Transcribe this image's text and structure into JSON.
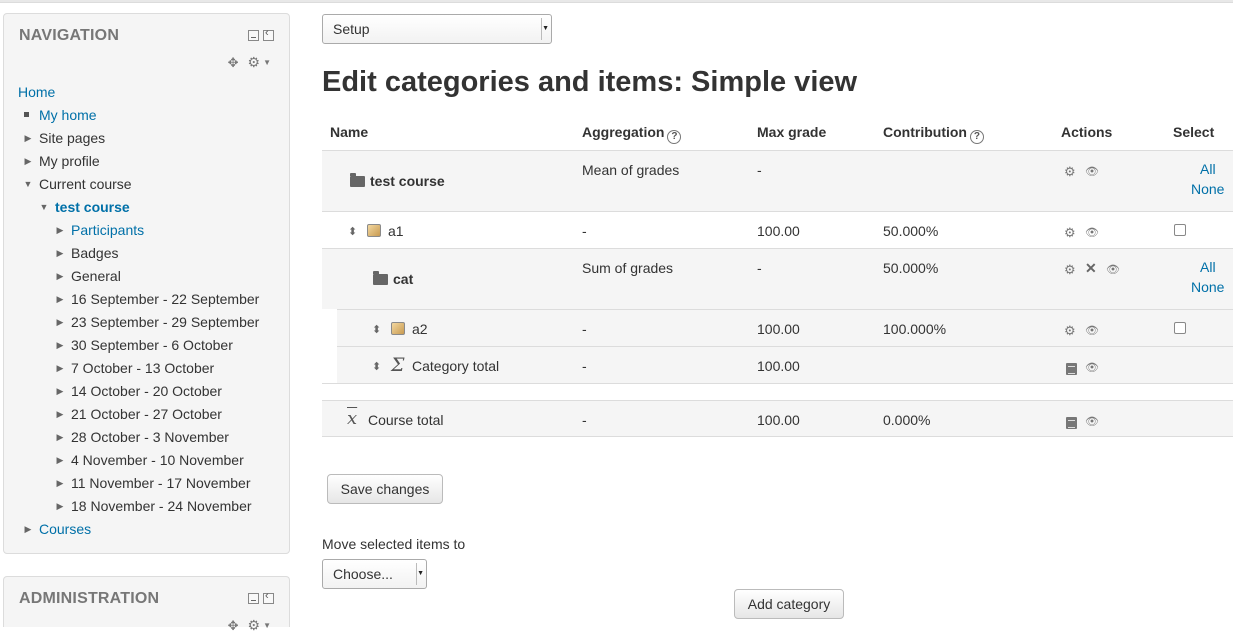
{
  "navigation": {
    "title": "NAVIGATION",
    "items": [
      {
        "label": "Home"
      },
      {
        "label": "My home"
      },
      {
        "label": "Site pages"
      },
      {
        "label": "My profile"
      },
      {
        "label": "Current course"
      },
      {
        "label": "test course"
      },
      {
        "label": "Participants"
      },
      {
        "label": "Badges"
      },
      {
        "label": "General"
      },
      {
        "label": "16 September - 22 September"
      },
      {
        "label": "23 September - 29 September"
      },
      {
        "label": "30 September - 6 October"
      },
      {
        "label": "7 October - 13 October"
      },
      {
        "label": "14 October - 20 October"
      },
      {
        "label": "21 October - 27 October"
      },
      {
        "label": "28 October - 3 November"
      },
      {
        "label": "4 November - 10 November"
      },
      {
        "label": "11 November - 17 November"
      },
      {
        "label": "18 November - 24 November"
      },
      {
        "label": "Courses"
      }
    ]
  },
  "administration": {
    "title": "ADMINISTRATION"
  },
  "view_select": {
    "value": "Setup"
  },
  "page_title": "Edit categories and items: Simple view",
  "table": {
    "headers": {
      "name": "Name",
      "aggregation": "Aggregation",
      "max_grade": "Max grade",
      "contribution": "Contribution",
      "actions": "Actions",
      "select": "Select"
    },
    "rows": [
      {
        "name": "test course",
        "aggregation": "Mean of grades",
        "max_grade": "-",
        "contribution": "",
        "select_all": "All",
        "select_none": "None"
      },
      {
        "name": "a1",
        "aggregation": "-",
        "max_grade": "100.00",
        "contribution": "50.000%"
      },
      {
        "name": "cat",
        "aggregation": "Sum of grades",
        "max_grade": "-",
        "contribution": "50.000%",
        "select_all": "All",
        "select_none": "None"
      },
      {
        "name": "a2",
        "aggregation": "-",
        "max_grade": "100.00",
        "contribution": "100.000%"
      },
      {
        "name": "Category total",
        "aggregation": "-",
        "max_grade": "100.00",
        "contribution": ""
      },
      {
        "name": "Course total",
        "aggregation": "-",
        "max_grade": "100.00",
        "contribution": "0.000%"
      }
    ]
  },
  "save_button": "Save changes",
  "move_label": "Move selected items to",
  "move_select": {
    "value": "Choose..."
  },
  "add_category_button": "Add category",
  "colors": {
    "link": "#0070a8",
    "sidebar_bg": "#f5f5f5",
    "row_shade": "#f5f5f5"
  }
}
